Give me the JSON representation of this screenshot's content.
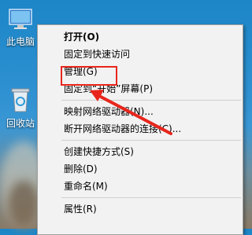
{
  "desktop": {
    "icons": [
      {
        "label": "此电脑",
        "icon": "computer-icon"
      },
      {
        "label": "回收站",
        "icon": "recycle-bin-icon"
      }
    ]
  },
  "context_menu": {
    "groups": [
      [
        {
          "label": "打开(O)",
          "bold": true
        },
        {
          "label": "固定到快速访问"
        },
        {
          "label": "管理(G)",
          "highlighted": true
        },
        {
          "label": "固定到“开始”屏幕(P)"
        }
      ],
      [
        {
          "label": "映射网络驱动器(N)..."
        },
        {
          "label": "断开网络驱动器的连接(C)..."
        }
      ],
      [
        {
          "label": "创建快捷方式(S)"
        },
        {
          "label": "删除(D)"
        },
        {
          "label": "重命名(M)"
        }
      ],
      [
        {
          "label": "属性(R)"
        }
      ]
    ]
  },
  "annotation": {
    "box_color": "#e8261c",
    "arrow_color": "#e8261c"
  }
}
